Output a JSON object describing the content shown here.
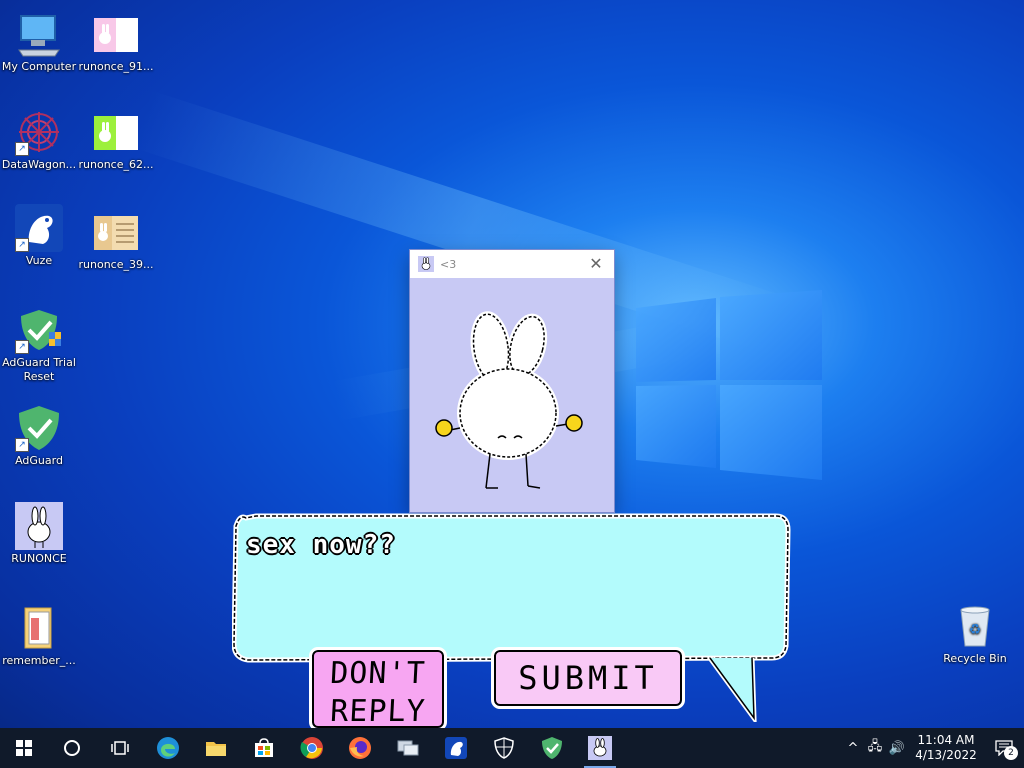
{
  "desktop": {
    "icons": [
      {
        "label": "My Computer",
        "icon": "computer-icon"
      },
      {
        "label": "runonce_91...",
        "icon": "image-file-icon"
      },
      {
        "label": "DataWagon...",
        "icon": "datawagon-icon"
      },
      {
        "label": "runonce_62...",
        "icon": "image-file-icon"
      },
      {
        "label": "Vuze",
        "icon": "vuze-frog-icon"
      },
      {
        "label": "runonce_39...",
        "icon": "image-file-icon"
      },
      {
        "label": "AdGuard Trial Reset",
        "icon": "adguard-shield-icon"
      },
      {
        "label": "AdGuard",
        "icon": "adguard-shield-icon"
      },
      {
        "label": "RUNONCE",
        "icon": "bunny-icon"
      },
      {
        "label": "remember_...",
        "icon": "folder-icon"
      },
      {
        "label": "Recycle Bin",
        "icon": "recycle-bin-icon"
      }
    ]
  },
  "popup": {
    "title": "<3",
    "close_glyph": "✕"
  },
  "dialog": {
    "message": "sex now??",
    "dont_reply_line1": "DON'T",
    "dont_reply_line2": "REPLY",
    "submit_label": "SUBMIT"
  },
  "taskbar": {
    "apps": [
      "start-icon",
      "search-icon",
      "task-view-icon",
      "edge-icon",
      "file-explorer-icon",
      "store-icon",
      "chrome-icon",
      "firefox-icon",
      "network-icon",
      "vuze-icon",
      "security-shield-icon",
      "adguard-icon",
      "runonce-bunny-icon"
    ],
    "active": "runonce-bunny-icon",
    "clock_time": "11:04 AM",
    "clock_date": "4/13/2022",
    "notification_count": "2"
  },
  "colors": {
    "accent": "#0a56d8",
    "popup_bg": "#c8c9f4",
    "bubble_bg": "#b3fbfc",
    "dont_reply_bg": "#f7a6f2",
    "submit_bg": "#f9c9f6",
    "taskbar_bg": "#101a2a"
  }
}
